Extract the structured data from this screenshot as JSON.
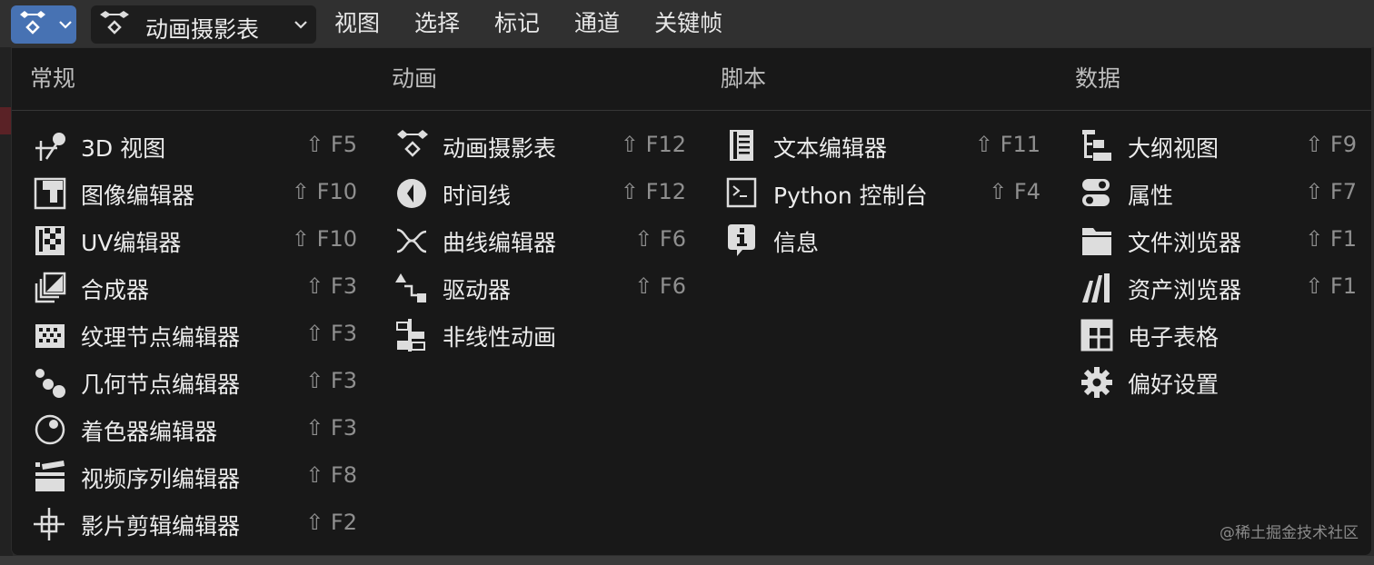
{
  "header": {
    "editor_type_icon": "dopesheet-icon",
    "mode": {
      "label": "动画摄影表",
      "icon": "dopesheet-icon"
    },
    "menus": [
      "视图",
      "选择",
      "标记",
      "通道",
      "关键帧"
    ]
  },
  "columns": [
    {
      "title": "常规",
      "items": [
        {
          "label": "3D 视图",
          "shortcut": "⇧ F5",
          "icon": "3d-viewport-icon"
        },
        {
          "label": "图像编辑器",
          "shortcut": "⇧ F10",
          "icon": "image-editor-icon"
        },
        {
          "label": "UV编辑器",
          "shortcut": "⇧ F10",
          "icon": "uv-editor-icon"
        },
        {
          "label": "合成器",
          "shortcut": "⇧ F3",
          "icon": "compositor-icon"
        },
        {
          "label": "纹理节点编辑器",
          "shortcut": "⇧ F3",
          "icon": "texture-node-icon"
        },
        {
          "label": "几何节点编辑器",
          "shortcut": "⇧ F3",
          "icon": "geometry-node-icon"
        },
        {
          "label": "着色器编辑器",
          "shortcut": "⇧ F3",
          "icon": "shader-editor-icon"
        },
        {
          "label": "视频序列编辑器",
          "shortcut": "⇧ F8",
          "icon": "video-sequencer-icon"
        },
        {
          "label": "影片剪辑编辑器",
          "shortcut": "⇧ F2",
          "icon": "movie-clip-icon"
        }
      ]
    },
    {
      "title": "动画",
      "items": [
        {
          "label": "动画摄影表",
          "shortcut": "⇧ F12",
          "icon": "dopesheet-icon"
        },
        {
          "label": "时间线",
          "shortcut": "⇧ F12",
          "icon": "timeline-icon"
        },
        {
          "label": "曲线编辑器",
          "shortcut": "⇧ F6",
          "icon": "graph-editor-icon"
        },
        {
          "label": "驱动器",
          "shortcut": "⇧ F6",
          "icon": "drivers-icon"
        },
        {
          "label": "非线性动画",
          "shortcut": "",
          "icon": "nla-icon"
        }
      ]
    },
    {
      "title": "脚本",
      "items": [
        {
          "label": "文本编辑器",
          "shortcut": "⇧ F11",
          "icon": "text-editor-icon"
        },
        {
          "label": "Python 控制台",
          "shortcut": "⇧ F4",
          "icon": "python-console-icon"
        },
        {
          "label": "信息",
          "shortcut": "",
          "icon": "info-icon"
        }
      ]
    },
    {
      "title": "数据",
      "items": [
        {
          "label": "大纲视图",
          "shortcut": "⇧ F9",
          "icon": "outliner-icon"
        },
        {
          "label": "属性",
          "shortcut": "⇧ F7",
          "icon": "properties-icon"
        },
        {
          "label": "文件浏览器",
          "shortcut": "⇧ F1",
          "icon": "file-browser-icon"
        },
        {
          "label": "资产浏览器",
          "shortcut": "⇧ F1",
          "icon": "asset-browser-icon"
        },
        {
          "label": "电子表格",
          "shortcut": "",
          "icon": "spreadsheet-icon"
        },
        {
          "label": "偏好设置",
          "shortcut": "",
          "icon": "preferences-icon"
        }
      ]
    }
  ],
  "watermark": "@稀土掘金技术社区",
  "colors": {
    "accent": "#4772b3",
    "panel_bg": "#181818",
    "header_bg": "#303030",
    "text": "#ececec",
    "shortcut": "#8f8f8f"
  }
}
